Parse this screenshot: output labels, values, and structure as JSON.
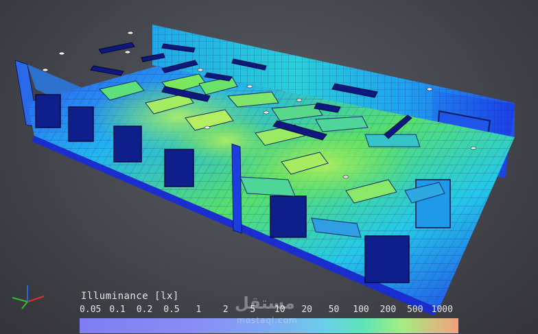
{
  "legend": {
    "title": "Illuminance [lx]",
    "ticks": [
      "0.05",
      "0.1",
      "0.2",
      "0.5",
      "1",
      "2",
      "5",
      "10",
      "20",
      "50",
      "100",
      "200",
      "500",
      "1000"
    ]
  },
  "watermark": {
    "logo_text": "مستقل",
    "subtext": "mostaql.com"
  },
  "axes": {
    "x_color": "#e03030",
    "y_color": "#30c030",
    "z_color": "#3060e0"
  },
  "colors": {
    "background": "#45454d",
    "low": "#1b2ae0",
    "mid": "#17c6e6",
    "high": "#7ee848"
  }
}
